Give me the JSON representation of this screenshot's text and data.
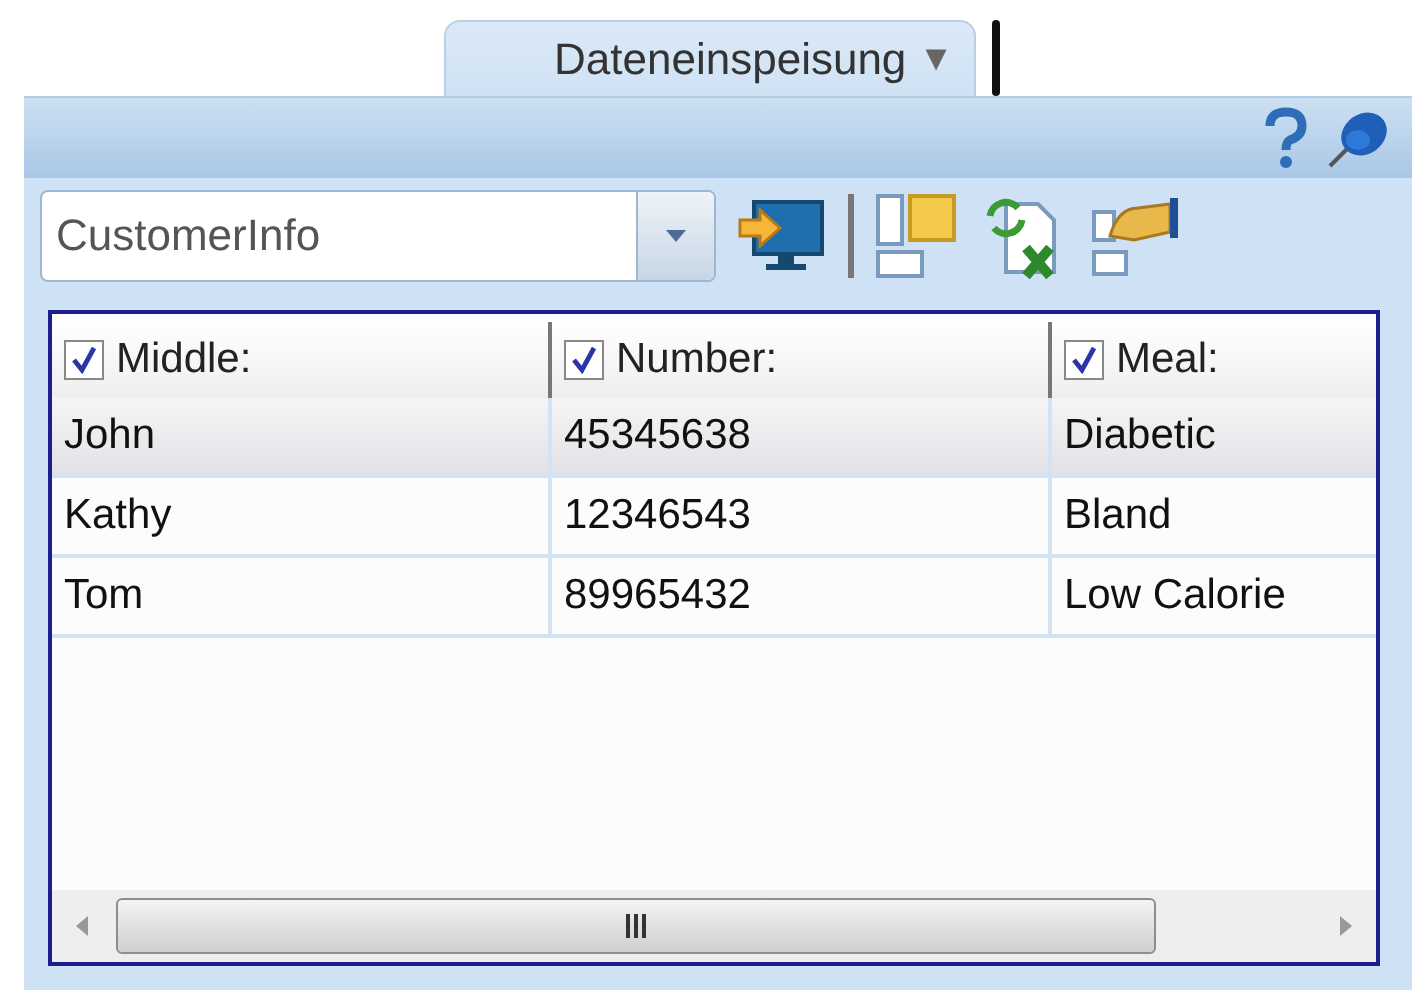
{
  "tab": {
    "label": "Dateneinspeisung",
    "menu_glyph": "▼"
  },
  "toolbar": {
    "dropdown": {
      "value": "CustomerInfo"
    }
  },
  "table": {
    "columns": [
      {
        "label": "Middle:",
        "checked": true
      },
      {
        "label": "Number:",
        "checked": true
      },
      {
        "label": "Meal:",
        "checked": true
      }
    ],
    "rows": [
      {
        "cells": [
          "John",
          "45345638",
          "Diabetic"
        ],
        "selected": true
      },
      {
        "cells": [
          "Kathy",
          "12346543",
          "Bland"
        ],
        "selected": false
      },
      {
        "cells": [
          "Tom",
          "89965432",
          "Low Calorie"
        ],
        "selected": false
      }
    ]
  }
}
